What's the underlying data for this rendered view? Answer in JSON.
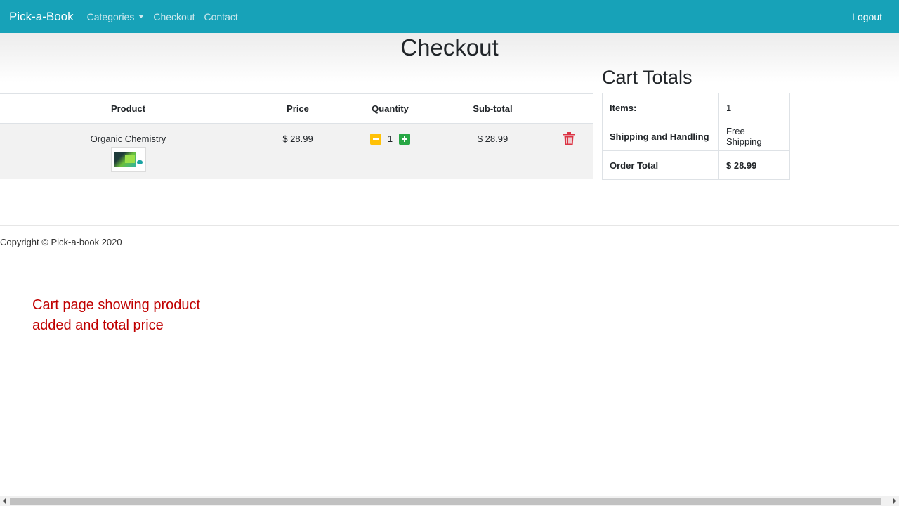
{
  "nav": {
    "brand": "Pick-a-Book",
    "links": [
      "Categories",
      "Checkout",
      "Contact"
    ],
    "logout": "Logout"
  },
  "page": {
    "title": "Checkout"
  },
  "cart": {
    "headers": [
      "Product",
      "Price",
      "Quantity",
      "Sub-total"
    ],
    "rows": [
      {
        "product": "Organic Chemistry",
        "price": "$ 28.99",
        "quantity": "1",
        "subtotal": "$ 28.99"
      }
    ]
  },
  "totals": {
    "title": "Cart Totals",
    "rows": [
      {
        "label": "Items:",
        "value": "1"
      },
      {
        "label": "Shipping and Handling",
        "value": "Free Shipping"
      },
      {
        "label": "Order Total",
        "value": "$ 28.99"
      }
    ]
  },
  "footer": {
    "copyright": "Copyright © Pick-a-book 2020"
  },
  "caption": {
    "line1": "Cart page showing product",
    "line2": "added and total price"
  },
  "colors": {
    "navbar": "#17a2b8",
    "minus": "#ffc107",
    "plus": "#28a745",
    "trash": "#dc3545",
    "caption": "#c00000"
  }
}
